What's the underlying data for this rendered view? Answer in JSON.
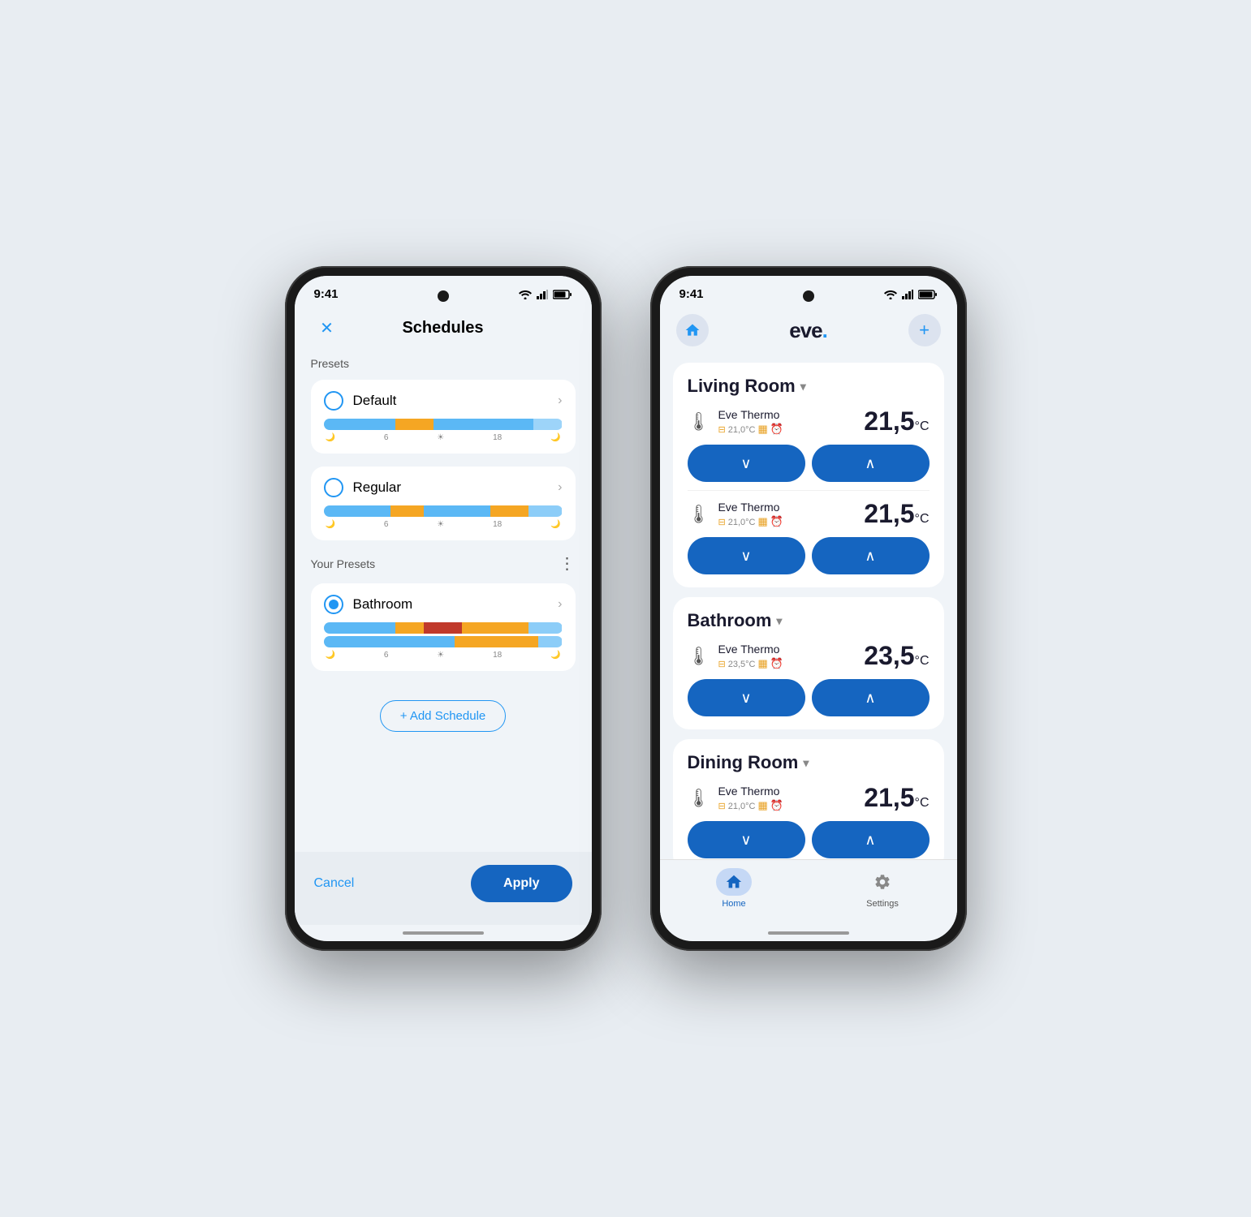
{
  "phone1": {
    "statusBar": {
      "time": "9:41",
      "wifi": "▲",
      "signal": "▲",
      "battery": "▊"
    },
    "header": {
      "title": "Schedules",
      "closeLabel": "✕"
    },
    "presetsLabel": "Presets",
    "presets": [
      {
        "name": "Default",
        "selected": false,
        "bars": [
          {
            "width": "30%",
            "color": "#5bb8f5"
          },
          {
            "width": "15%",
            "color": "#f5a623"
          },
          {
            "width": "45%",
            "color": "#5bb8f5"
          },
          {
            "width": "10%",
            "color": "#5bb8f5"
          }
        ]
      },
      {
        "name": "Regular",
        "selected": false,
        "bars": [
          {
            "width": "28%",
            "color": "#5bb8f5"
          },
          {
            "width": "14%",
            "color": "#f5a623"
          },
          {
            "width": "30%",
            "color": "#5bb8f5"
          },
          {
            "width": "15%",
            "color": "#f5a623"
          },
          {
            "width": "13%",
            "color": "#5bb8f5"
          }
        ]
      }
    ],
    "yourPresetsLabel": "Your Presets",
    "yourPresets": [
      {
        "name": "Bathroom",
        "selected": true,
        "bars": [
          {
            "width": "30%",
            "color": "#5bb8f5"
          },
          {
            "width": "12%",
            "color": "#f5a623"
          },
          {
            "width": "18%",
            "color": "#c0392b"
          },
          {
            "width": "30%",
            "color": "#f5a623"
          },
          {
            "width": "10%",
            "color": "#5bb8f5"
          }
        ],
        "bars2": [
          {
            "width": "55%",
            "color": "#5bb8f5"
          },
          {
            "width": "35%",
            "color": "#f5a623"
          },
          {
            "width": "10%",
            "color": "#5bb8f5"
          }
        ]
      }
    ],
    "addScheduleLabel": "+ Add Schedule",
    "tickLabels": [
      "🌙",
      "6",
      "☀",
      "18",
      "🌙"
    ],
    "cancelLabel": "Cancel",
    "applyLabel": "Apply"
  },
  "phone2": {
    "statusBar": {
      "time": "9:41"
    },
    "header": {
      "logoText": "eve",
      "logoDot": "."
    },
    "rooms": [
      {
        "name": "Living Room",
        "devices": [
          {
            "name": "Eve Thermo",
            "subTemp": "21,0°C",
            "temp": "21,5",
            "unit": "°C"
          },
          {
            "name": "Eve Thermo",
            "subTemp": "21,0°C",
            "temp": "21,5",
            "unit": "°C"
          }
        ]
      },
      {
        "name": "Bathroom",
        "devices": [
          {
            "name": "Eve Thermo",
            "subTemp": "23,5°C",
            "temp": "23,5",
            "unit": "°C"
          }
        ]
      },
      {
        "name": "Dining Room",
        "devices": [
          {
            "name": "Eve Thermo",
            "subTemp": "21,0°C",
            "temp": "21,5",
            "unit": "°C"
          }
        ]
      }
    ],
    "nav": {
      "homeLabel": "Home",
      "settingsLabel": "Settings"
    }
  }
}
